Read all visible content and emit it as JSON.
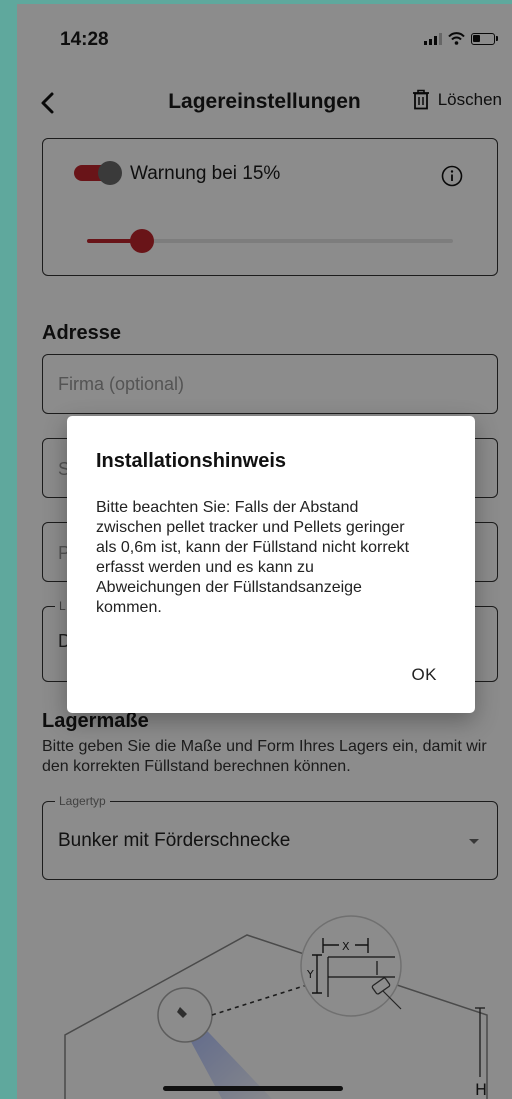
{
  "status_bar": {
    "time": "14:28",
    "icons": [
      "signal-icon",
      "wifi-icon",
      "battery-icon"
    ]
  },
  "nav": {
    "title": "Lagereinstellungen",
    "back_icon": "chevron-left-icon",
    "delete_icon": "trash-icon",
    "delete_label": "Löschen"
  },
  "warning": {
    "label": "Warnung bei 15%",
    "enabled": true,
    "level_percent": 15,
    "info_icon": "info-icon"
  },
  "address": {
    "heading": "Adresse",
    "company_placeholder": "Firma (optional)",
    "street_partial": "S",
    "postal_partial": "P",
    "country_legend_partial": "L",
    "country_partial": "D"
  },
  "dimensions": {
    "heading": "Lagermaße",
    "helper": "Bitte geben Sie die Maße und Form Ihres Lagers ein, damit wir den korrekten Füllstand berechnen können.",
    "type_legend": "Lagertyp",
    "type_value": "Bunker mit Förderschnecke"
  },
  "diagram_labels": {
    "x": "X",
    "y": "Y",
    "h": "H"
  },
  "dialog": {
    "title": "Installationshinweis",
    "body": "Bitte beachten Sie: Falls der Abstand\nzwischen pellet tracker und Pellets geringer\nals 0,6m ist, kann der Füllstand nicht korrekt\nerfasst werden und es kann zu\nAbweichungen der Füllstandsanzeige\nkommen.",
    "ok_label": "OK"
  },
  "colors": {
    "accent": "#c0262d",
    "frame": "#5fa89d",
    "scrim": "rgba(0,0,0,0.45)"
  }
}
